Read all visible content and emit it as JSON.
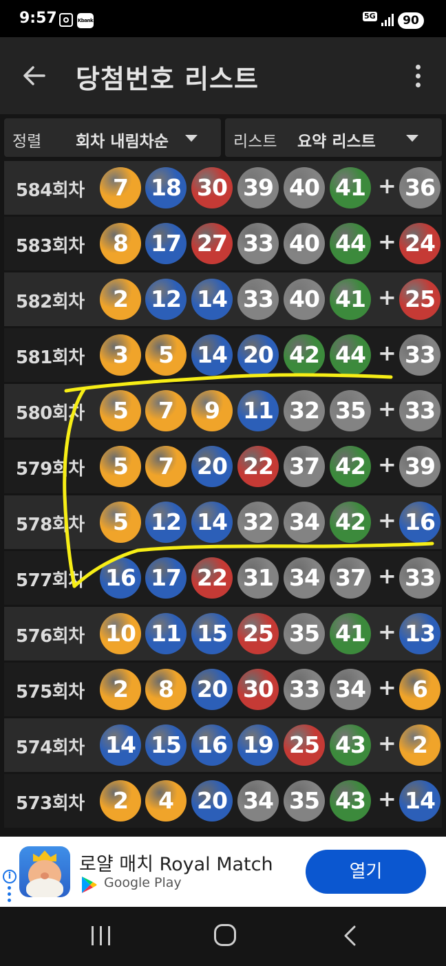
{
  "status": {
    "time": "9:57",
    "kbank": "Kbank",
    "network": "5G",
    "battery": "90"
  },
  "header": {
    "title": "당첨번호 리스트"
  },
  "filters": {
    "sort_label": "정렬",
    "sort_value": "회차 내림차순",
    "list_label": "리스트",
    "list_value": "요약 리스트"
  },
  "colors": {
    "yellow": "#f0a42a",
    "blue": "#2c5fb8",
    "red": "#c53a35",
    "gray": "#838383",
    "green": "#3c8a3c",
    "annotation": "#f7ee16"
  },
  "plus_sign": "+",
  "rounds": [
    {
      "label": "584회차",
      "numbers": [
        "7",
        "18",
        "30",
        "39",
        "40",
        "41"
      ],
      "bonus": "36"
    },
    {
      "label": "583회차",
      "numbers": [
        "8",
        "17",
        "27",
        "33",
        "40",
        "44"
      ],
      "bonus": "24"
    },
    {
      "label": "582회차",
      "numbers": [
        "2",
        "12",
        "14",
        "33",
        "40",
        "41"
      ],
      "bonus": "25"
    },
    {
      "label": "581회차",
      "numbers": [
        "3",
        "5",
        "14",
        "20",
        "42",
        "44"
      ],
      "bonus": "33"
    },
    {
      "label": "580회차",
      "numbers": [
        "5",
        "7",
        "9",
        "11",
        "32",
        "35"
      ],
      "bonus": "33"
    },
    {
      "label": "579회차",
      "numbers": [
        "5",
        "7",
        "20",
        "22",
        "37",
        "42"
      ],
      "bonus": "39"
    },
    {
      "label": "578회차",
      "numbers": [
        "5",
        "12",
        "14",
        "32",
        "34",
        "42"
      ],
      "bonus": "16"
    },
    {
      "label": "577회차",
      "numbers": [
        "16",
        "17",
        "22",
        "31",
        "34",
        "37"
      ],
      "bonus": "33"
    },
    {
      "label": "576회차",
      "numbers": [
        "10",
        "11",
        "15",
        "25",
        "35",
        "41"
      ],
      "bonus": "13"
    },
    {
      "label": "575회차",
      "numbers": [
        "2",
        "8",
        "20",
        "30",
        "33",
        "34"
      ],
      "bonus": "6"
    },
    {
      "label": "574회차",
      "numbers": [
        "14",
        "15",
        "16",
        "19",
        "25",
        "43"
      ],
      "bonus": "2"
    },
    {
      "label": "573회차",
      "numbers": [
        "2",
        "4",
        "20",
        "34",
        "35",
        "43"
      ],
      "bonus": "14"
    }
  ],
  "ad": {
    "title": "로얄 매치 Royal Match",
    "store": "Google Play",
    "button": "열기",
    "info_icon": "i"
  }
}
